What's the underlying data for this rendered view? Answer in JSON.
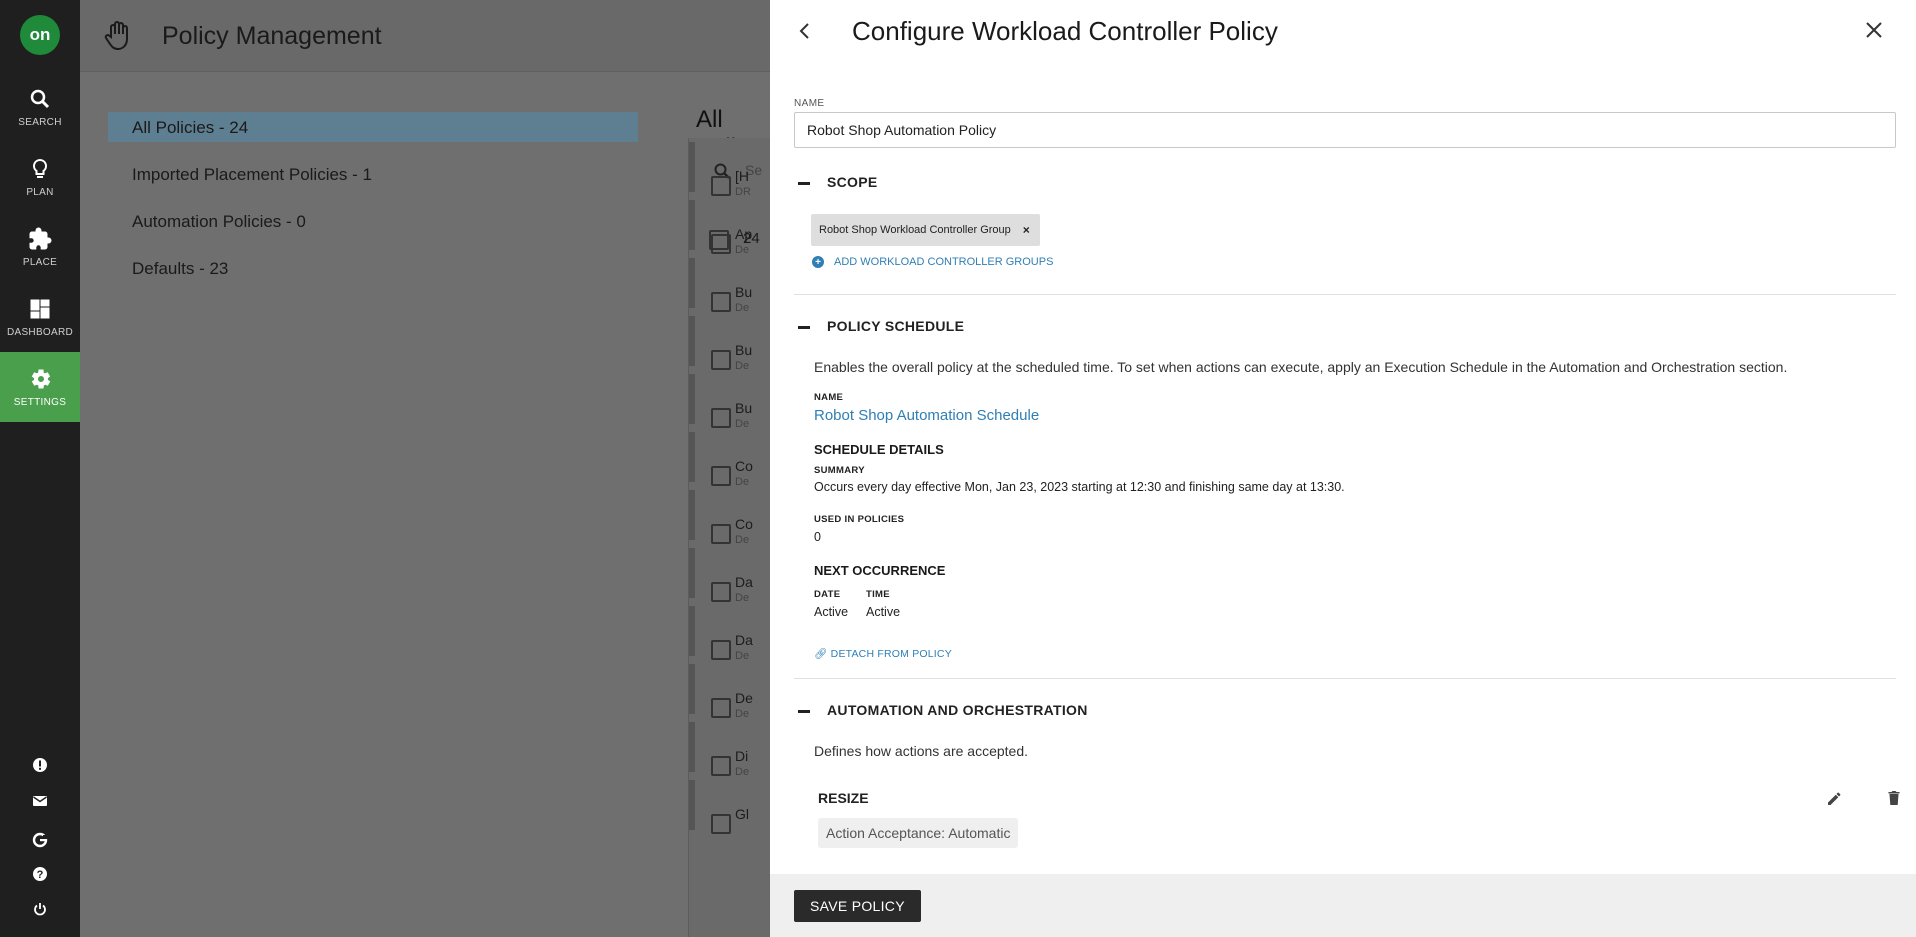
{
  "nav": {
    "logo": "on",
    "items": [
      {
        "label": "SEARCH",
        "icon": "search-icon"
      },
      {
        "label": "PLAN",
        "icon": "lightbulb-icon"
      },
      {
        "label": "PLACE",
        "icon": "puzzle-icon"
      },
      {
        "label": "DASHBOARD",
        "icon": "dashboard-icon"
      },
      {
        "label": "SETTINGS",
        "icon": "gear-icon"
      }
    ],
    "bottom_icons": [
      "alert-icon",
      "mail-icon",
      "google-icon",
      "help-icon",
      "power-icon"
    ]
  },
  "page": {
    "title": "Policy Management",
    "filters": [
      "All Policies - 24",
      "Imported Placement Policies - 1",
      "Automation Policies - 0",
      "Defaults - 23"
    ],
    "list_title": "All Polic",
    "search_placeholder": "Se",
    "count_stub": "24",
    "rows": [
      {
        "t": "[H",
        "s": "DR"
      },
      {
        "t": "Ap",
        "s": "De"
      },
      {
        "t": "Bu",
        "s": "De"
      },
      {
        "t": "Bu",
        "s": "De"
      },
      {
        "t": "Bu",
        "s": "De"
      },
      {
        "t": "Co",
        "s": "De"
      },
      {
        "t": "Co",
        "s": "De"
      },
      {
        "t": "Da",
        "s": "De"
      },
      {
        "t": "Da",
        "s": "De"
      },
      {
        "t": "De",
        "s": "De"
      },
      {
        "t": "Di",
        "s": "De"
      },
      {
        "t": "Gl",
        "s": ""
      }
    ]
  },
  "panel": {
    "title": "Configure Workload Controller Policy",
    "name_label": "NAME",
    "name_value": "Robot Shop Automation Policy",
    "scope": {
      "title": "SCOPE",
      "chip": "Robot Shop Workload Controller Group",
      "chip_remove": "×",
      "add_link": "ADD WORKLOAD CONTROLLER GROUPS"
    },
    "schedule": {
      "title": "POLICY SCHEDULE",
      "description": "Enables the overall policy at the scheduled time. To set when actions can execute, apply an Execution Schedule in the Automation and Orchestration section.",
      "name_label": "NAME",
      "name_value": "Robot Shop Automation Schedule",
      "details_head": "SCHEDULE DETAILS",
      "summary_label": "SUMMARY",
      "summary_value": "Occurs every day effective Mon, Jan 23, 2023 starting at 12:30 and finishing same day at 13:30.",
      "used_label": "USED IN POLICIES",
      "used_value": "0",
      "next_head": "NEXT OCCURRENCE",
      "date_label": "DATE",
      "date_value": "Active",
      "time_label": "TIME",
      "time_value": "Active",
      "detach": "DETACH FROM POLICY"
    },
    "automation": {
      "title": "AUTOMATION AND ORCHESTRATION",
      "description": "Defines how actions are accepted.",
      "resize_title": "RESIZE",
      "acceptance": "Action Acceptance: Automatic"
    },
    "save_label": "SAVE POLICY"
  }
}
